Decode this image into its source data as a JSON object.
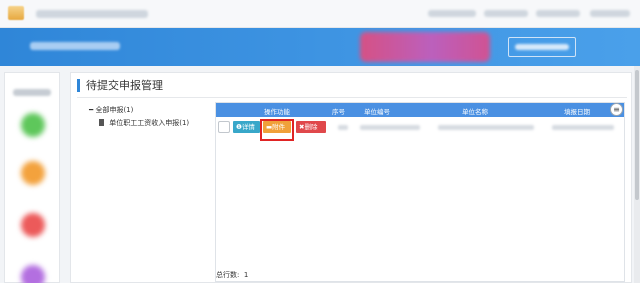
{
  "page_title": "待提交申报管理",
  "tree": {
    "root_label": "全部申报(1)",
    "child_label": "单位职工工资收入申报(1)"
  },
  "grid": {
    "columns": [
      "操作功能",
      "序号",
      "单位编号",
      "单位名称",
      "填报日期"
    ],
    "row_actions": {
      "detail": "详情",
      "attach": "附件",
      "delete": "删除"
    },
    "total_label": "总行数:",
    "total_count": "1"
  },
  "icons": {
    "detail": "info-icon",
    "attach": "folder-icon",
    "delete": "close-icon",
    "tree_collapse": "minus-icon",
    "tree_doc": "document-icon",
    "column_menu": "menu-icon"
  },
  "colors": {
    "header_blue": "#3f95e3",
    "grid_header": "#4a90e2",
    "detail_btn": "#38a7c9",
    "attach_btn": "#f0a13a",
    "delete_btn": "#e0484b",
    "highlight": "#e02424"
  }
}
